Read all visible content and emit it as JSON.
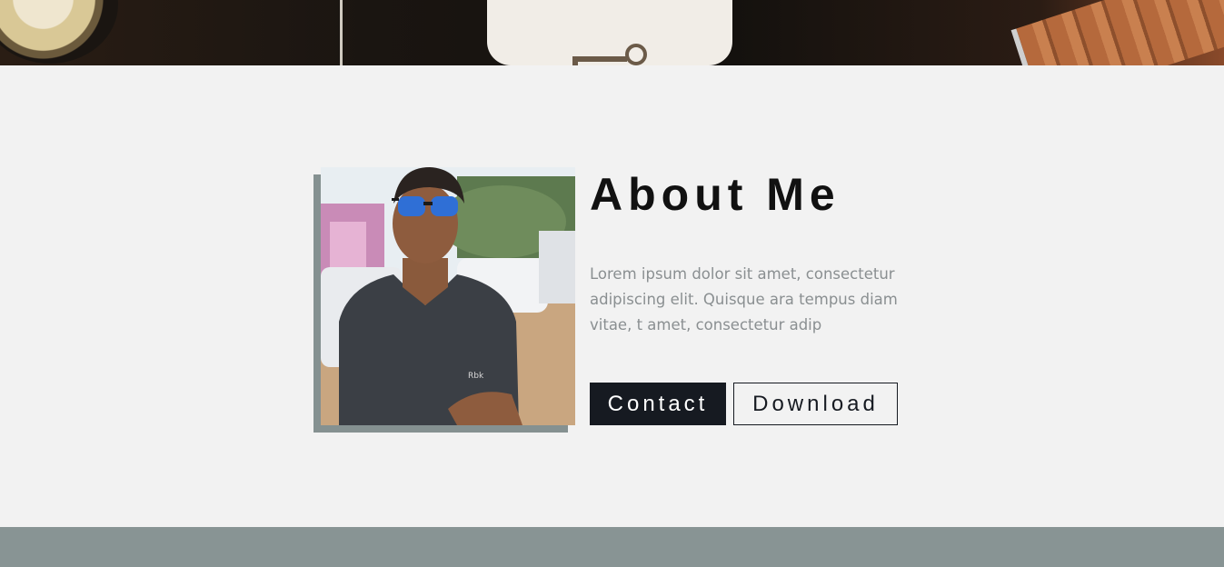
{
  "about": {
    "title": "About Me",
    "description": "Lorem ipsum dolor sit amet, consectetur adipiscing elit. Quisque ara tempus diam vitae, t amet, consectetur adip",
    "contact_label": "Contact",
    "download_label": "Download"
  },
  "colors": {
    "page_background": "#f2f2f2",
    "accent_gray": "#889494",
    "button_dark": "#161a21",
    "body_text": "#8a8f91"
  }
}
